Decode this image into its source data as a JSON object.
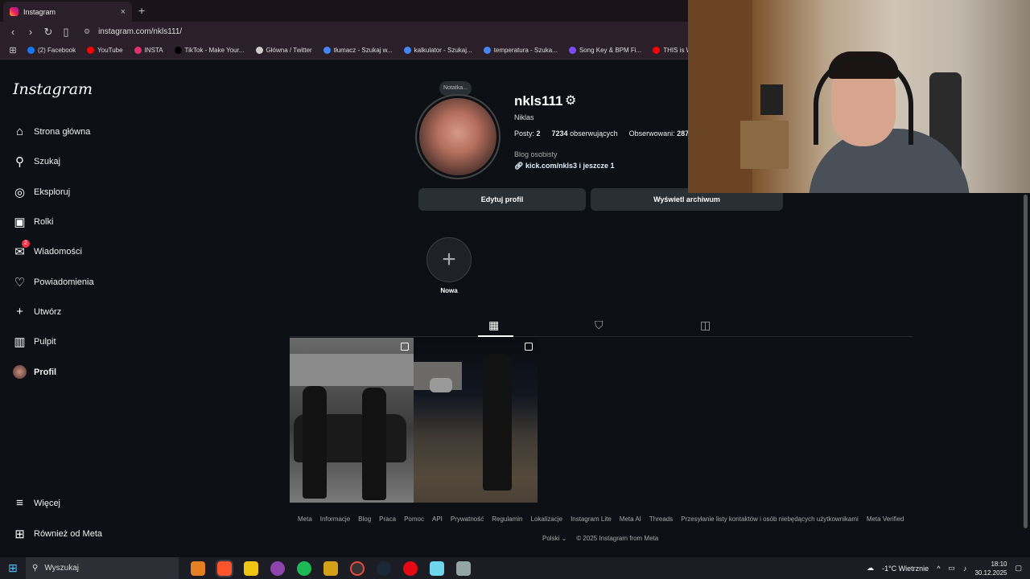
{
  "browser": {
    "tab_title": "Instagram",
    "tab_close": "×",
    "new_tab": "+",
    "url": "instagram.com/nkls111/",
    "bookmarks": [
      {
        "label": "(2) Facebook",
        "color": "#1877f2"
      },
      {
        "label": "YouTube",
        "color": "#ff0000"
      },
      {
        "label": "INSTA",
        "color": "#e1306c"
      },
      {
        "label": "TikTok - Make Your...",
        "color": "#000000"
      },
      {
        "label": "Główna / Twitter",
        "color": "#cccccc"
      },
      {
        "label": "tłumacz - Szukaj w...",
        "color": "#4285f4"
      },
      {
        "label": "kalkulator - Szukaj...",
        "color": "#4285f4"
      },
      {
        "label": "temperatura - Szuka...",
        "color": "#4285f4"
      },
      {
        "label": "Song Key & BPM Fi...",
        "color": "#7c4dff"
      },
      {
        "label": "THIS is W",
        "color": "#ff0000"
      }
    ]
  },
  "sidebar": {
    "logo": "Instagram",
    "items": [
      {
        "label": "Strona główna",
        "icon": "home-icon",
        "glyph": "⌂"
      },
      {
        "label": "Szukaj",
        "icon": "search-icon",
        "glyph": "⚲"
      },
      {
        "label": "Eksploruj",
        "icon": "compass-icon",
        "glyph": "◎"
      },
      {
        "label": "Rolki",
        "icon": "reels-icon",
        "glyph": "▣"
      },
      {
        "label": "Wiadomości",
        "icon": "messenger-icon",
        "glyph": "✉",
        "badge": "2"
      },
      {
        "label": "Powiadomienia",
        "icon": "heart-icon",
        "glyph": "♡"
      },
      {
        "label": "Utwórz",
        "icon": "plus-icon",
        "glyph": "+"
      },
      {
        "label": "Pulpit",
        "icon": "dashboard-icon",
        "glyph": "▥"
      },
      {
        "label": "Profil",
        "icon": "avatar",
        "glyph": ""
      }
    ],
    "bottom_items": [
      {
        "label": "Więcej",
        "icon": "menu-icon",
        "glyph": "≡"
      },
      {
        "label": "Również od Meta",
        "icon": "meta-apps-icon",
        "glyph": "⊞"
      }
    ]
  },
  "profile": {
    "note": "Notatka...",
    "username": "nkls111",
    "full_name": "Niklas",
    "posts_label": "Posty:",
    "posts": "2",
    "followers": "7234",
    "followers_label": "obserwujących",
    "following_label": "Obserwowani:",
    "following": "287",
    "category": "Blog osobisty",
    "link": "kick.com/nkls3 i jeszcze 1",
    "edit_button": "Edytuj profil",
    "archive_button": "Wyświetl archiwum",
    "new_highlight": "Nowa"
  },
  "footer": {
    "links": [
      "Meta",
      "Informacje",
      "Blog",
      "Praca",
      "Pomoc",
      "API",
      "Prywatność",
      "Regulamin",
      "Lokalizacje",
      "Instagram Lite",
      "Meta AI",
      "Threads",
      "Przesyłanie listy kontaktów i osób niebędących użytkownikami",
      "Meta Verified"
    ],
    "language": "Polski",
    "copyright": "© 2025 Instagram from Meta"
  },
  "taskbar": {
    "search_placeholder": "Wyszukaj",
    "weather": "-1°C  Wietrznie",
    "time": "18:10",
    "date": "30.12.2025"
  }
}
